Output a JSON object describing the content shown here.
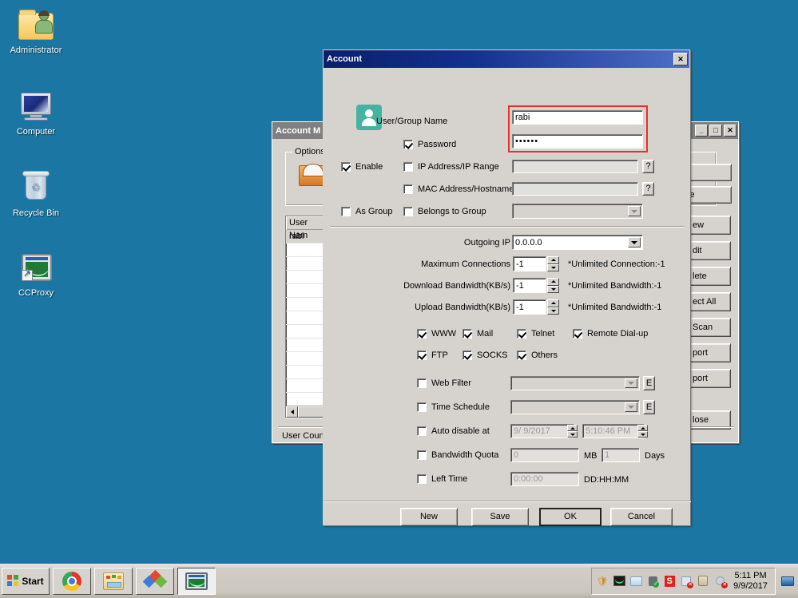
{
  "desktop": {
    "icons": [
      {
        "name": "administrator",
        "label": "Administrator"
      },
      {
        "name": "computer",
        "label": "Computer"
      },
      {
        "name": "recycle-bin",
        "label": "Recycle Bin"
      },
      {
        "name": "ccproxy",
        "label": "CCProxy"
      }
    ]
  },
  "account_manager": {
    "title": "Account M",
    "options_group": "Options",
    "list": {
      "column_header": "User Nam",
      "rows": [
        "rabi"
      ]
    },
    "status": "User Count:",
    "buttons_right": [
      {
        "name": "new",
        "label": "ew"
      },
      {
        "name": "edit",
        "label": "dit"
      },
      {
        "name": "delete",
        "label": "lete"
      },
      {
        "name": "select-all",
        "label": "ect All"
      },
      {
        "name": "auto-scan",
        "label": "Scan"
      },
      {
        "name": "export",
        "label": "port"
      },
      {
        "name": "import",
        "label": "port"
      },
      {
        "name": "close",
        "label": "lose"
      }
    ],
    "options_buttons": [
      {
        "name": "option-top",
        "label": ""
      },
      {
        "name": "option-rule",
        "label": "le"
      }
    ],
    "titlebar_buttons": {
      "minimize": "_",
      "maximize": "□",
      "close": "✕"
    }
  },
  "account_dialog": {
    "title": "Account",
    "close_label": "✕",
    "user_group_name": {
      "label": "User/Group Name",
      "value": "rabi"
    },
    "password": {
      "label": "Password",
      "checked": true,
      "value": "••••••"
    },
    "enable": {
      "label": "Enable",
      "checked": true
    },
    "as_group": {
      "label": "As Group",
      "checked": false
    },
    "ip_address": {
      "label": "IP Address/IP Range",
      "checked": false,
      "value": "",
      "help": "?"
    },
    "mac_address": {
      "label": "MAC Address/Hostname",
      "checked": false,
      "value": "",
      "help": "?"
    },
    "belongs_to_group": {
      "label": "Belongs to Group",
      "checked": false,
      "value": ""
    },
    "outgoing_ip": {
      "label": "Outgoing IP",
      "value": "0.0.0.0"
    },
    "max_connections": {
      "label": "Maximum Connections",
      "value": "-1",
      "hint": "*Unlimited Connection:-1"
    },
    "download_bandwidth": {
      "label": "Download Bandwidth(KB/s)",
      "value": "-1",
      "hint": "*Unlimited Bandwidth:-1"
    },
    "upload_bandwidth": {
      "label": "Upload Bandwidth(KB/s)",
      "value": "-1",
      "hint": "*Unlimited Bandwidth:-1"
    },
    "protocols": [
      {
        "name": "www",
        "label": "WWW",
        "checked": true
      },
      {
        "name": "mail",
        "label": "Mail",
        "checked": true
      },
      {
        "name": "telnet",
        "label": "Telnet",
        "checked": true
      },
      {
        "name": "remote-dial-up",
        "label": "Remote Dial-up",
        "checked": true
      },
      {
        "name": "ftp",
        "label": "FTP",
        "checked": true
      },
      {
        "name": "socks",
        "label": "SOCKS",
        "checked": true
      },
      {
        "name": "others",
        "label": "Others",
        "checked": true
      }
    ],
    "web_filter": {
      "label": "Web Filter",
      "checked": false,
      "value": "",
      "edit_label": "E"
    },
    "time_schedule": {
      "label": "Time Schedule",
      "checked": false,
      "value": "",
      "edit_label": "E"
    },
    "auto_disable": {
      "label": "Auto disable at",
      "checked": false,
      "date": "9/ 9/2017",
      "time": "5:10:46 PM"
    },
    "bandwidth_quota": {
      "label": "Bandwidth Quota",
      "checked": false,
      "mb_value": "0",
      "mb_unit": "MB",
      "days_value": "1",
      "days_unit": "Days"
    },
    "left_time": {
      "label": "Left Time",
      "checked": false,
      "value": "0:00:00",
      "format": "DD:HH:MM"
    },
    "buttons": [
      {
        "name": "new",
        "label": "New",
        "default": false
      },
      {
        "name": "save",
        "label": "Save",
        "default": false
      },
      {
        "name": "ok",
        "label": "OK",
        "default": true
      },
      {
        "name": "cancel",
        "label": "Cancel",
        "default": false
      }
    ]
  },
  "taskbar": {
    "start_label": "Start",
    "items": [
      {
        "name": "chrome",
        "label": ""
      },
      {
        "name": "file-explorer",
        "label": ""
      },
      {
        "name": "paint-colors",
        "label": ""
      },
      {
        "name": "ccproxy",
        "label": "",
        "active": true
      }
    ],
    "tray_icons": [
      "shield-icon",
      "ccproxy-icon",
      "disk-icon",
      "usb-check-icon",
      "s-icon",
      "network-error-icon",
      "plug-icon",
      "volume-mute-icon"
    ],
    "clock_time": "5:11 PM",
    "clock_date": "9/9/2017"
  },
  "colors": {
    "desktop_bg": "#1b76a3",
    "dialog_title_start": "#0a1f6b",
    "dialog_title_end": "#4f6fc8",
    "highlight_red": "#e8312b",
    "avatar": "#45b3a0",
    "face3d": "#d6d3ce"
  }
}
